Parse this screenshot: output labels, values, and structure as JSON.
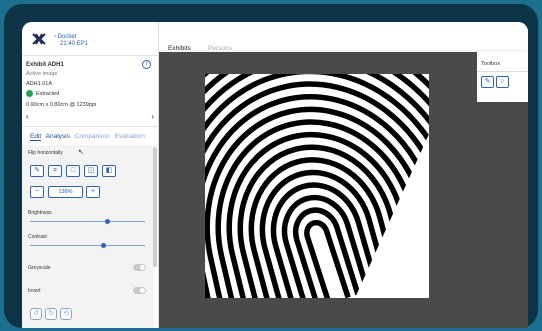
{
  "header": {
    "back_label": "Docket",
    "time": "21:40:EP1",
    "tabs": [
      {
        "label": "Exhibits",
        "active": true
      },
      {
        "label": "Persons",
        "active": false
      }
    ]
  },
  "exhibit": {
    "title": "Exhibit ADH1",
    "subtitle": "Active image",
    "image_id": "ADH1.01A",
    "status": "Extracted",
    "dimensions": "0.90cm x 0.80cm @ 1239ppi"
  },
  "edit_tabs": [
    "Edit",
    "Analysis",
    "Comparison",
    "Evaluation"
  ],
  "edit": {
    "flip_label": "Flip horizontally",
    "zoom_value": "138%",
    "brightness_label": "Brightness",
    "brightness_value": 0.65,
    "contrast_label": "Contrast",
    "contrast_value": 0.62,
    "greyscale_label": "Greyscale",
    "greyscale_on": false,
    "invert_label": "Invert",
    "invert_on": false
  },
  "toolbox": {
    "title": "Toolbox",
    "tools": [
      "pencil-icon",
      "circle-icon"
    ]
  },
  "colors": {
    "accent": "#2a63c4",
    "success": "#22a05a",
    "canvas": "#4a4a4a"
  }
}
